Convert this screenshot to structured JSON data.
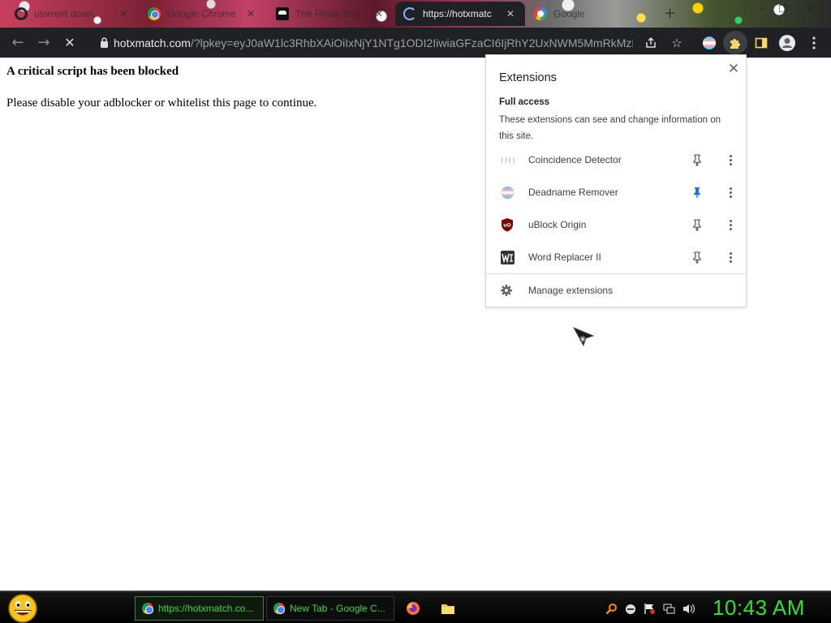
{
  "tabs": [
    {
      "title": "utorrent down",
      "favicon": "opera-icon",
      "active": false
    },
    {
      "title": "Google Chrome",
      "favicon": "chrome-icon",
      "active": false
    },
    {
      "title": "The Pirate Bay",
      "favicon": "pirate-bay-icon",
      "active": false
    },
    {
      "title": "https://hotxmatc",
      "favicon": "loading-spinner-icon",
      "active": true
    },
    {
      "title": "Google",
      "favicon": "google-icon",
      "active": false
    }
  ],
  "window_controls": {
    "minimize": "–",
    "restore": "❐",
    "close": "✕"
  },
  "toolbar": {
    "url_domain": "hotxmatch.com",
    "url_rest": "/?lpkey=eyJ0aW1lc3RhbXAiOiIxNjY1NTg1ODI2IiwiaGFzaCI6IjRhY2UxNWM5MmRkMzE...",
    "back_icon": "←",
    "forward_icon": "→",
    "stop_icon": "✕"
  },
  "page": {
    "heading": "A critical script has been blocked",
    "message": "Please disable your adblocker or whitelist this page to continue."
  },
  "extensions_popup": {
    "title": "Extensions",
    "section_title": "Full access",
    "section_description": "These extensions can see and change information on this site.",
    "items": [
      {
        "name": "Coincidence Detector",
        "pinned": false,
        "icon": "coincidence-detector-icon"
      },
      {
        "name": "Deadname Remover",
        "pinned": true,
        "icon": "deadname-remover-icon"
      },
      {
        "name": "uBlock Origin",
        "pinned": false,
        "icon": "ublock-origin-icon"
      },
      {
        "name": "Word Replacer II",
        "pinned": false,
        "icon": "word-replacer-icon"
      }
    ],
    "manage_label": "Manage extensions",
    "colors": {
      "pin_active": "#1a73e8",
      "pin_inactive": "#5f6368"
    }
  },
  "taskbar": {
    "tasks": [
      {
        "label": "https://hotxmatch.co...",
        "active": true
      },
      {
        "label": "New Tab - Google C...",
        "active": false
      }
    ],
    "clock": "10:43 AM",
    "accent_color": "#2fe12f"
  }
}
